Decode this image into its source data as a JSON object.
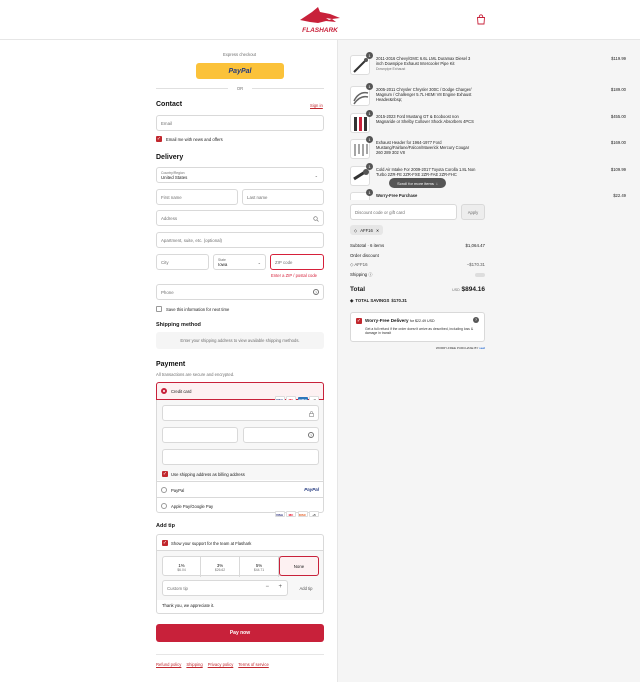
{
  "brand": {
    "name": "FLASHARK",
    "logo_color": "#c8213a",
    "accent": "#c8213a"
  },
  "express": {
    "label": "Express checkout",
    "paypal_label": "PayPal",
    "or": "OR"
  },
  "contact": {
    "title": "Contact",
    "sign_in": "Sign in",
    "email_placeholder": "Email",
    "news_label": "Email me with news and offers"
  },
  "delivery": {
    "title": "Delivery",
    "country_label": "Country/Region",
    "country_value": "United States",
    "first_name": "First name",
    "last_name": "Last name",
    "address": "Address",
    "apartment": "Apartment, suite, etc. (optional)",
    "city": "City",
    "state_label": "State",
    "state_value": "Iowa",
    "zip": "ZIP code",
    "zip_error": "Enter a ZIP / postal code",
    "phone": "Phone",
    "save_label": "Save this information for next time"
  },
  "shipping_method": {
    "title": "Shipping method",
    "placeholder": "Enter your shipping address to view available shipping methods."
  },
  "payment": {
    "title": "Payment",
    "subtitle": "All transactions are secure and encrypted.",
    "credit_card": "Credit card",
    "cards": [
      "VISA",
      "MC",
      "AMEX",
      "+3"
    ],
    "billing_label": "Use shipping address as billing address",
    "paypal": "PayPal",
    "applepay": "Apple Pay/Google Pay",
    "apple_cards": [
      "VISA",
      "MC",
      "DISC",
      "+5"
    ]
  },
  "tip": {
    "title": "Add tip",
    "support_label": "Show your support for the team at Flashark",
    "options": [
      {
        "pct": "1%",
        "amt": "$6.04"
      },
      {
        "pct": "3%",
        "amt": "$26.62"
      },
      {
        "pct": "5%",
        "amt": "$44.71"
      },
      {
        "pct": "None",
        "amt": ""
      }
    ],
    "custom_placeholder": "Custom tip",
    "minus": "−",
    "plus": "+",
    "add_label": "Add tip",
    "thanks": "Thank you, we appreciate it."
  },
  "pay_button": "Pay now",
  "footer_links": [
    "Refund policy",
    "Shipping",
    "Privacy policy",
    "Terms of service"
  ],
  "cart": {
    "items": [
      {
        "qty": "1",
        "name": "2011-2016 Chevy/GMC 6.6L LML Duramax Diesel 3 inch Downpipe Exhaust Intercooler Pipe Kit",
        "sub": "Downpipe Exhaust",
        "price": "$119.99"
      },
      {
        "qty": "1",
        "name": "2005-2011 Chrysler Chrysler 300C / Dodge Charger/ Magnum / Challenger 5.7L HEMI V8 Engine Exhaust Header&nbsp;",
        "sub": "",
        "price": "$189.00"
      },
      {
        "qty": "1",
        "name": "2015-2023 Ford Mustang GT & Ecoboost non Magnaride or Shelby Collover Shock Absorbers 4PCS",
        "sub": "",
        "price": "$455.00"
      },
      {
        "qty": "1",
        "name": "Exhaust Header for 1964-1977 Ford Mustang/Fairlane/Falcon/Maverick Mercury Cougar 260 289 302 V8",
        "sub": "",
        "price": "$169.00"
      },
      {
        "qty": "1",
        "name": "Cold Air Intake For 2009-2017 Toyota Corolla 1.8L Non Turbo 2ZR-FE 2ZR-FXE 2ZR-FAE 2ZR-FHC",
        "sub": "",
        "price": "$109.99"
      },
      {
        "qty": "1",
        "name": "Worry-Free Purchase",
        "sub": "",
        "price": "$22.49"
      }
    ],
    "scroll_hint": "Scroll for more items",
    "discount_placeholder": "Discount code or gift card",
    "apply": "Apply",
    "code_tag": "AFF16",
    "subtotal_label": "Subtotal · 6 items",
    "subtotal_value": "$1,064.47",
    "order_discount_label": "Order discount",
    "discount_code": "AFF16",
    "discount_value": "−$170.31",
    "shipping_label": "Shipping",
    "total_label": "Total",
    "currency": "USD",
    "total_value": "$894.16",
    "savings_label": "TOTAL SAVINGS",
    "savings_value": "$170.31",
    "wf_title": "Worry-Free Delivery",
    "wf_price": "for $22.49 USD",
    "wf_desc": "Get a full refund if the order doesn't arrive as described, including loss & damage in transit",
    "powered": "WORRY-FREE PURCHASE BY",
    "powered_brand": "seel"
  }
}
